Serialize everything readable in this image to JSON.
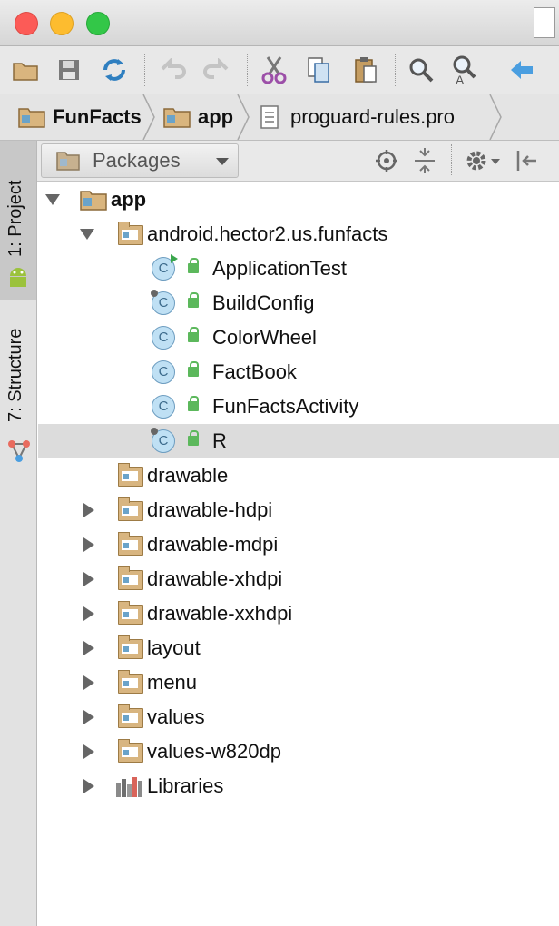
{
  "breadcrumb": {
    "items": [
      {
        "label": "FunFacts",
        "icon": "module-folder-icon"
      },
      {
        "label": "app",
        "icon": "module-folder-icon"
      },
      {
        "label": "proguard-rules.pro",
        "icon": "text-file-icon"
      }
    ]
  },
  "toolbar": {
    "buttons": [
      "open-icon",
      "save-icon",
      "sync-icon",
      "undo-icon",
      "redo-icon",
      "cut-icon",
      "copy-icon",
      "paste-icon",
      "find-icon",
      "replace-icon",
      "back-icon"
    ]
  },
  "sidebar": {
    "tabs": [
      {
        "label": "1: Project",
        "active": true
      },
      {
        "label": "7: Structure",
        "active": false
      }
    ]
  },
  "panel": {
    "view_mode": "Packages"
  },
  "tree": {
    "root": "app",
    "package": "android.hector2.us.funfacts",
    "classes": [
      {
        "name": "ApplicationTest"
      },
      {
        "name": "BuildConfig"
      },
      {
        "name": "ColorWheel"
      },
      {
        "name": "FactBook"
      },
      {
        "name": "FunFactsActivity"
      },
      {
        "name": "R"
      }
    ],
    "folders": [
      "drawable",
      "drawable-hdpi",
      "drawable-mdpi",
      "drawable-xhdpi",
      "drawable-xxhdpi",
      "layout",
      "menu",
      "values",
      "values-w820dp"
    ],
    "libraries": "Libraries"
  },
  "colors": {
    "selection": "#dcdcdc",
    "folder": "#d8b580",
    "class_icon": "#bfe0f4",
    "access_lock": "#5cb85c"
  }
}
